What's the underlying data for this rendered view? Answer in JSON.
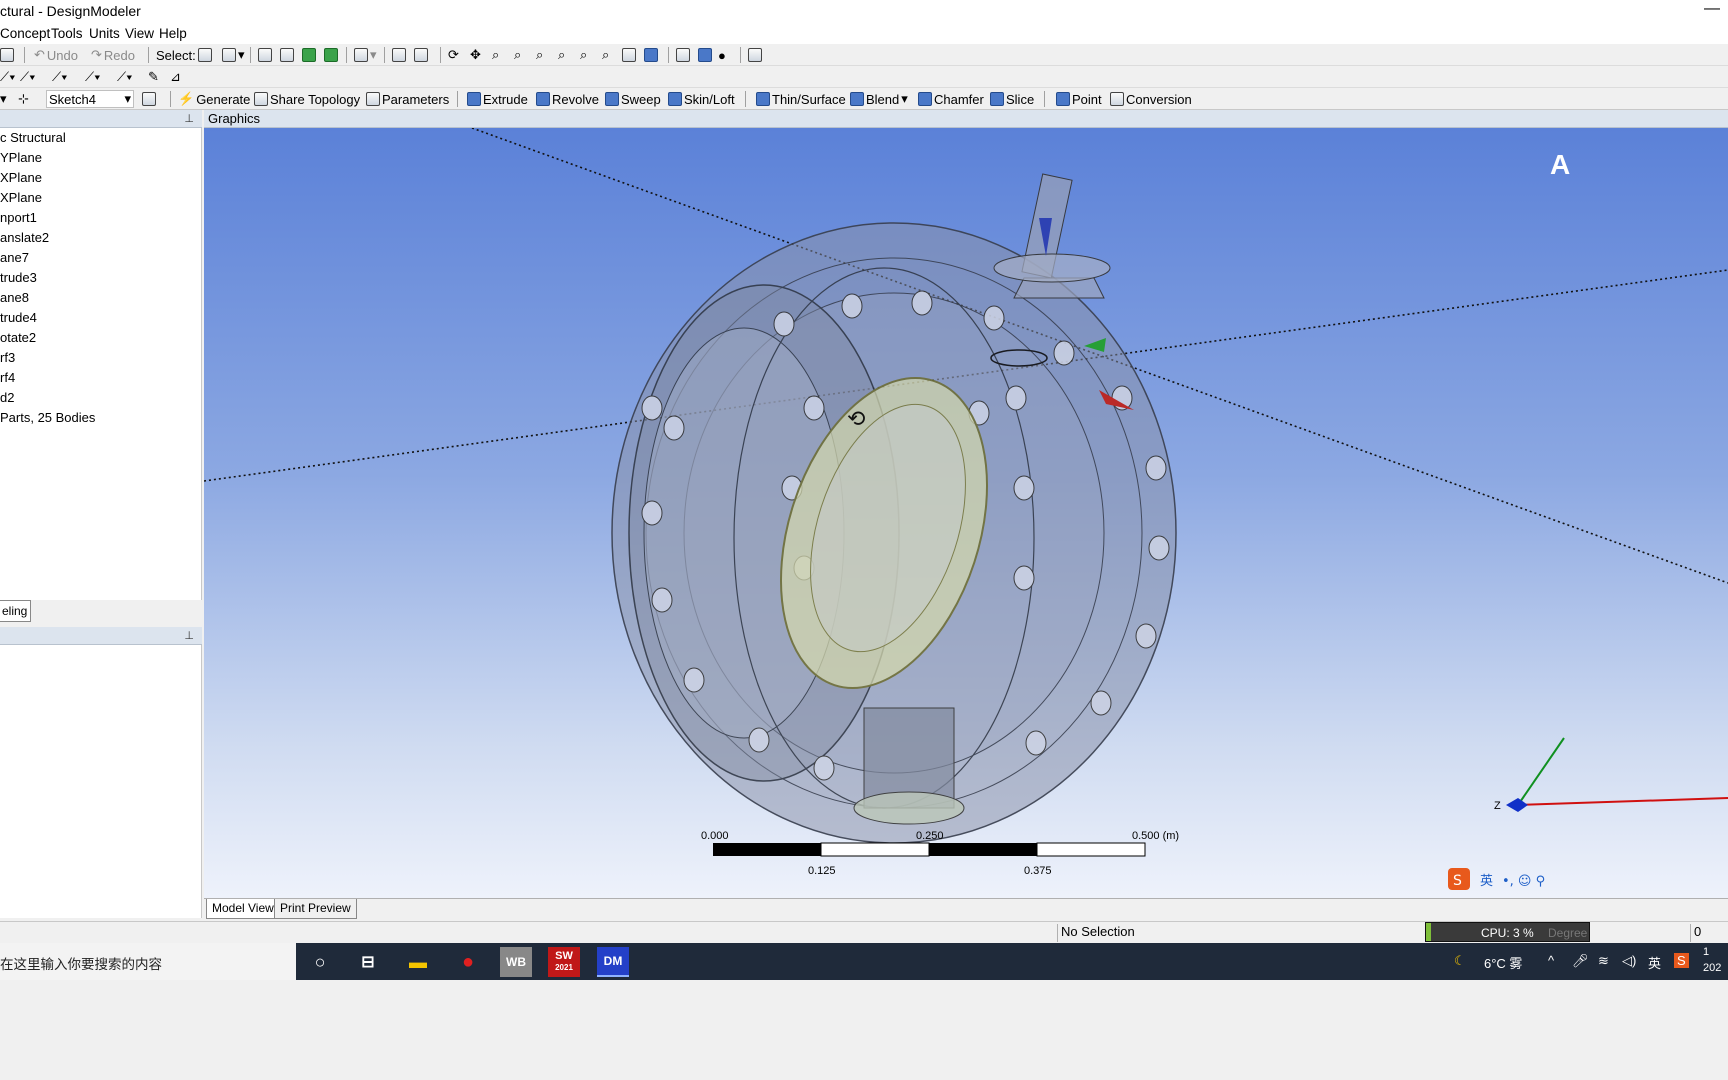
{
  "window": {
    "title": "ctural - DesignModeler",
    "minimize": "—"
  },
  "menu": [
    "Concept",
    "Tools",
    "Units",
    "View",
    "Help"
  ],
  "toolbar1": {
    "undo": "Undo",
    "redo": "Redo",
    "select": "Select:"
  },
  "toolbar3": {
    "sketch_value": "Sketch4",
    "generate": "Generate",
    "share_topology": "Share Topology",
    "parameters": "Parameters",
    "extrude": "Extrude",
    "revolve": "Revolve",
    "sweep": "Sweep",
    "skin_loft": "Skin/Loft",
    "thin_surface": "Thin/Surface",
    "blend": "Blend",
    "chamfer": "Chamfer",
    "slice": "Slice",
    "point": "Point",
    "conversion": "Conversion"
  },
  "tree": {
    "items": [
      "c Structural",
      "YPlane",
      "XPlane",
      "XPlane",
      "nport1",
      "anslate2",
      "ane7",
      "trude3",
      "ane8",
      "trude4",
      "otate2",
      "rf3",
      "rf4",
      "d2",
      " Parts, 25 Bodies"
    ],
    "tab_label": "eling",
    "pin": "⊥"
  },
  "graphics": {
    "header": "Graphics",
    "brand_letter": "A",
    "scale": {
      "top_labels": [
        "0.000",
        "0.250",
        "0.500 (m)"
      ],
      "bottom_labels": [
        "0.125",
        "0.375"
      ]
    },
    "axis_z": "Z"
  },
  "view_tabs": [
    "Model View",
    "Print Preview"
  ],
  "status": {
    "selection": "No Selection",
    "cpu": "CPU: 3 %",
    "cpu_fraction": 0.03,
    "units": "Degree",
    "right_value": "0"
  },
  "taskbar": {
    "search_placeholder": "在这里输入你要搜索的内容",
    "apps": [
      "WB",
      "SW",
      "DM"
    ],
    "sw_year": "2021",
    "weather": "6°C 雾",
    "ime": "英",
    "ime_tray": "英",
    "clock_line1": "1",
    "clock_line2": "202"
  },
  "colors": {
    "viewport_top": "#5b81d8",
    "accent_green": "#3aa34a",
    "taskbar": "#1f2a3a"
  }
}
